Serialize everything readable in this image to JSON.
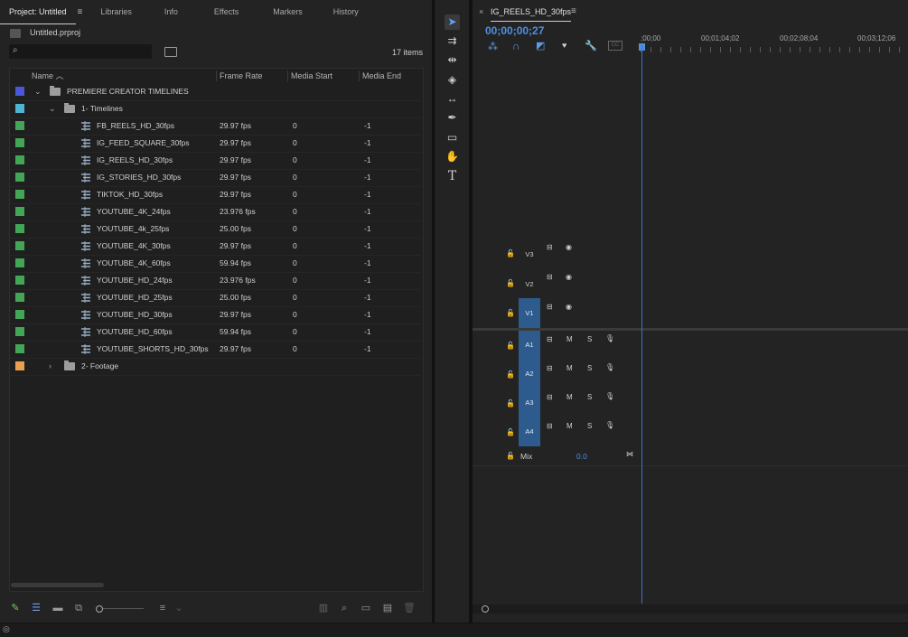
{
  "project_panel": {
    "tabs": [
      "Project: Untitled",
      "Libraries",
      "Info",
      "Effects",
      "Markers",
      "History"
    ],
    "project_file": "Untitled.prproj",
    "item_count": "17 items",
    "columns": [
      "Name",
      "Frame Rate",
      "Media Start",
      "Media End"
    ],
    "rows": [
      {
        "name": "PREMIERE CREATOR TIMELINES",
        "type": "folder",
        "indent": 0,
        "expanded": true,
        "color": "#4b57d8",
        "frame_rate": "",
        "media_start": "",
        "media_end": ""
      },
      {
        "name": "1- Timelines",
        "type": "folder",
        "indent": 1,
        "expanded": true,
        "color": "#4fb3d4",
        "frame_rate": "",
        "media_start": "",
        "media_end": ""
      },
      {
        "name": "FB_REELS_HD_30fps",
        "type": "sequence",
        "indent": 2,
        "color": "#43a556",
        "frame_rate": "29.97 fps",
        "media_start": "0",
        "media_end": "-1"
      },
      {
        "name": "IG_FEED_SQUARE_30fps",
        "type": "sequence",
        "indent": 2,
        "color": "#43a556",
        "frame_rate": "29.97 fps",
        "media_start": "0",
        "media_end": "-1"
      },
      {
        "name": "IG_REELS_HD_30fps",
        "type": "sequence",
        "indent": 2,
        "color": "#43a556",
        "frame_rate": "29.97 fps",
        "media_start": "0",
        "media_end": "-1"
      },
      {
        "name": "IG_STORIES_HD_30fps",
        "type": "sequence",
        "indent": 2,
        "color": "#43a556",
        "frame_rate": "29.97 fps",
        "media_start": "0",
        "media_end": "-1"
      },
      {
        "name": "TIKTOK_HD_30fps",
        "type": "sequence",
        "indent": 2,
        "color": "#43a556",
        "frame_rate": "29.97 fps",
        "media_start": "0",
        "media_end": "-1"
      },
      {
        "name": "YOUTUBE_4K_24fps",
        "type": "sequence",
        "indent": 2,
        "color": "#43a556",
        "frame_rate": "23.976 fps",
        "media_start": "0",
        "media_end": "-1"
      },
      {
        "name": "YOUTUBE_4k_25fps",
        "type": "sequence",
        "indent": 2,
        "color": "#43a556",
        "frame_rate": "25.00 fps",
        "media_start": "0",
        "media_end": "-1"
      },
      {
        "name": "YOUTUBE_4K_30fps",
        "type": "sequence",
        "indent": 2,
        "color": "#43a556",
        "frame_rate": "29.97 fps",
        "media_start": "0",
        "media_end": "-1"
      },
      {
        "name": "YOUTUBE_4K_60fps",
        "type": "sequence",
        "indent": 2,
        "color": "#43a556",
        "frame_rate": "59.94 fps",
        "media_start": "0",
        "media_end": "-1"
      },
      {
        "name": "YOUTUBE_HD_24fps",
        "type": "sequence",
        "indent": 2,
        "color": "#43a556",
        "frame_rate": "23.976 fps",
        "media_start": "0",
        "media_end": "-1"
      },
      {
        "name": "YOUTUBE_HD_25fps",
        "type": "sequence",
        "indent": 2,
        "color": "#43a556",
        "frame_rate": "25.00 fps",
        "media_start": "0",
        "media_end": "-1"
      },
      {
        "name": "YOUTUBE_HD_30fps",
        "type": "sequence",
        "indent": 2,
        "color": "#43a556",
        "frame_rate": "29.97 fps",
        "media_start": "0",
        "media_end": "-1"
      },
      {
        "name": "YOUTUBE_HD_60fps",
        "type": "sequence",
        "indent": 2,
        "color": "#43a556",
        "frame_rate": "59.94 fps",
        "media_start": "0",
        "media_end": "-1"
      },
      {
        "name": "YOUTUBE_SHORTS_HD_30fps",
        "type": "sequence",
        "indent": 2,
        "color": "#43a556",
        "frame_rate": "29.97 fps",
        "media_start": "0",
        "media_end": "-1"
      },
      {
        "name": "2- Footage",
        "type": "folder",
        "indent": 1,
        "expanded": false,
        "color": "#e8a050",
        "frame_rate": "",
        "media_start": "",
        "media_end": ""
      }
    ]
  },
  "timeline_panel": {
    "sequence_tab": "IG_REELS_HD_30fps",
    "timecode": "00;00;00;27",
    "ruler_ticks": [
      ";00;00",
      "00;01;04;02",
      "00;02;08;04",
      "00;03;12;06"
    ],
    "video_tracks": [
      "V3",
      "V2",
      "V1"
    ],
    "audio_tracks": [
      "A1",
      "A2",
      "A3",
      "A4"
    ],
    "mute_label": "M",
    "solo_label": "S",
    "mix_label": "Mix",
    "mix_value": "0.0"
  }
}
